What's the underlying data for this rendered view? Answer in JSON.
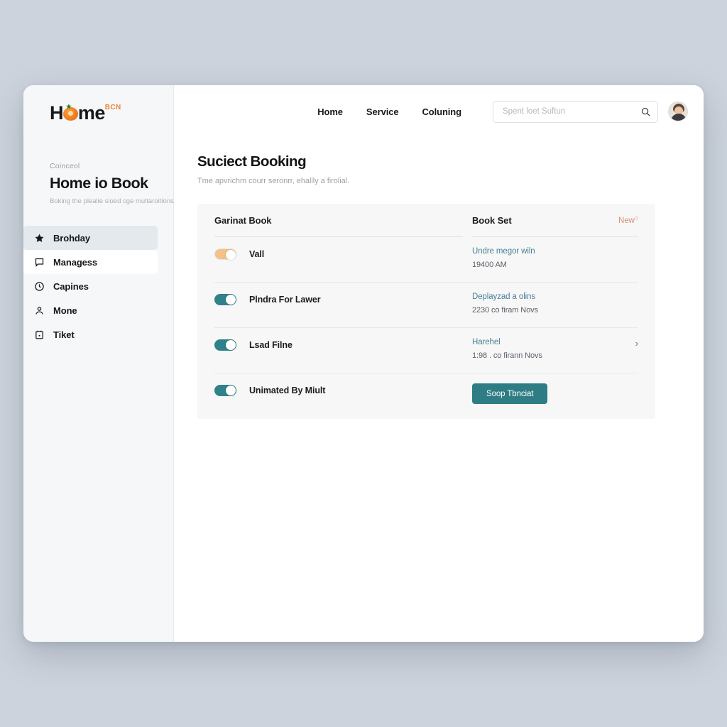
{
  "brand": {
    "name_part1": "H",
    "name_part2": "me",
    "superscript": "BCN",
    "accent_color": "#ef8234"
  },
  "sidebar": {
    "eyebrow": "Coinceol",
    "title": "Home io Book",
    "subtitle": "Boking the plealie sioed cge multaroitions",
    "items": [
      {
        "label": "Brohday",
        "icon": "star-icon",
        "active": true
      },
      {
        "label": "Managess",
        "icon": "message-icon",
        "active": false
      },
      {
        "label": "Capines",
        "icon": "clock-icon",
        "active": false
      },
      {
        "label": "Mone",
        "icon": "person-icon",
        "active": false
      },
      {
        "label": "Tiket",
        "icon": "clipboard-icon",
        "active": false
      }
    ]
  },
  "topbar": {
    "nav": [
      {
        "label": "Home"
      },
      {
        "label": "Service"
      },
      {
        "label": "Coluning"
      }
    ],
    "search": {
      "value": "",
      "placeholder": "Spent loet Suftun",
      "icon": "search-icon"
    },
    "avatar": "user-avatar"
  },
  "main": {
    "title": "Suciect Booking",
    "subtitle": "Tme apvrichm courr seronrr, ehallly a firolial."
  },
  "card": {
    "header": {
      "left_label": "Garinat Book",
      "right_label": "Book Set",
      "action_label": "New",
      "action_color": "#d3906f"
    },
    "rows": [
      {
        "toggle_state": "off",
        "toggle_color": "#f4c188",
        "title": "Vall",
        "link": "Undre megor wiln",
        "meta": "19400 AM",
        "chevron": false,
        "button": null
      },
      {
        "toggle_state": "on",
        "toggle_color": "#2f8289",
        "title": "Plndra For Lawer",
        "link": "Deplayzad a olins",
        "meta": "2230 co firam Novs",
        "chevron": false,
        "button": null
      },
      {
        "toggle_state": "on",
        "toggle_color": "#2f8289",
        "title": "Lsad Filne",
        "link": "Harehel",
        "meta": "1:98 . co firann Novs",
        "chevron": true,
        "button": null
      },
      {
        "toggle_state": "on",
        "toggle_color": "#2f8289",
        "title": "Unimated By Miult",
        "link": null,
        "meta": null,
        "chevron": false,
        "button": "Soop Tbnciat"
      }
    ]
  }
}
